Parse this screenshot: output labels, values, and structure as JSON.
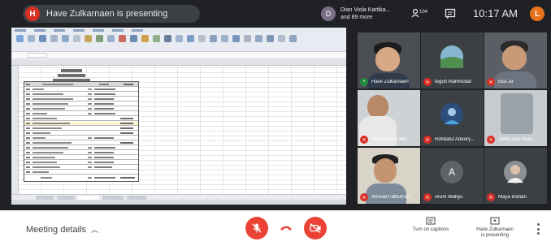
{
  "top_bar": {
    "presenter_initial": "H",
    "presenter_text": "Have Zulkarnaen is presenting",
    "viewers_initial": "D",
    "viewers_line1": "Dian Viola Kartika...",
    "viewers_line2": "and 89 more",
    "people_count": "104",
    "time": "10:17 AM",
    "me_initial": "L"
  },
  "tiles": [
    {
      "name": "Have Zulkarnaen",
      "kind": "video"
    },
    {
      "name": "teguh mahmudar",
      "kind": "avatar"
    },
    {
      "name": "Eka Ju",
      "kind": "video"
    },
    {
      "name": "Muhammad Ilmi",
      "kind": "video"
    },
    {
      "name": "Rofidatul Adeory...",
      "kind": "avatar"
    },
    {
      "name": "Dewa Ayu Yeshi...",
      "kind": "video"
    },
    {
      "name": "Ahmad Fathurroz...",
      "kind": "video"
    },
    {
      "name": "Arum Wahyu",
      "kind": "initial",
      "initial": "A"
    },
    {
      "name": "Maya Indrani",
      "kind": "avatar"
    }
  ],
  "bottom_bar": {
    "meeting_details": "Meeting details",
    "captions_label": "Turn on captions",
    "presenting_label_1": "Have Zulkarnaen",
    "presenting_label_2": "is presenting"
  },
  "colors": {
    "accent_red": "#ea4335",
    "dark_bg": "#202124",
    "tile_bg": "#3c4043"
  },
  "icons": [
    "people-icon",
    "chat-icon",
    "mic-off-icon",
    "hang-up-icon",
    "camera-off-icon",
    "captions-icon",
    "present-icon",
    "more-vert-icon"
  ]
}
